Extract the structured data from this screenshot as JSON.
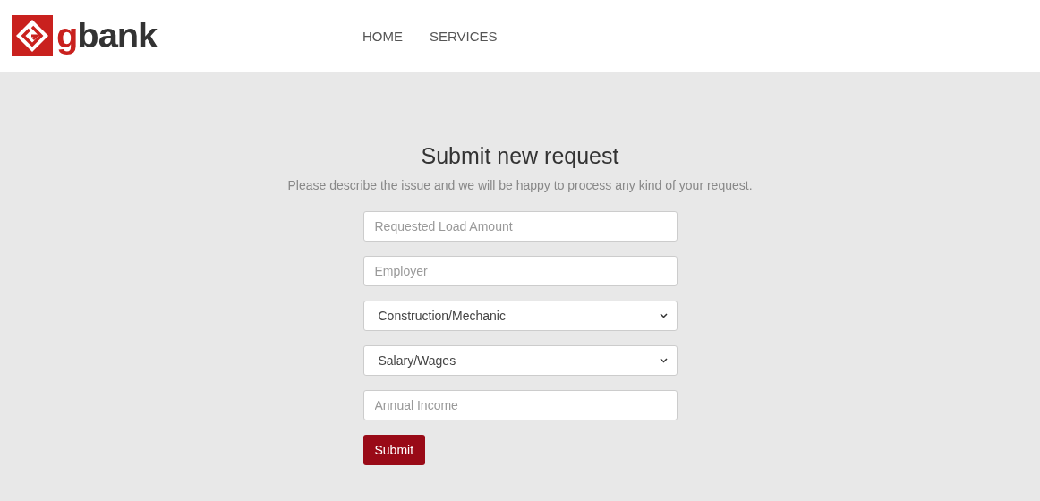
{
  "header": {
    "logo": {
      "accent": "g",
      "rest": "bank"
    },
    "nav": [
      {
        "label": "HOME"
      },
      {
        "label": "SERVICES"
      }
    ]
  },
  "form": {
    "title": "Submit new request",
    "subtitle": "Please describe the issue and we will be happy to process any kind of your request.",
    "fields": [
      {
        "kind": "text",
        "placeholder": "Requested Load Amount"
      },
      {
        "kind": "text",
        "placeholder": "Employer"
      },
      {
        "kind": "select",
        "value": "Construction/Mechanic"
      },
      {
        "kind": "select",
        "value": "Salary/Wages"
      },
      {
        "kind": "text",
        "placeholder": "Annual Income"
      }
    ],
    "submit": "Submit"
  }
}
